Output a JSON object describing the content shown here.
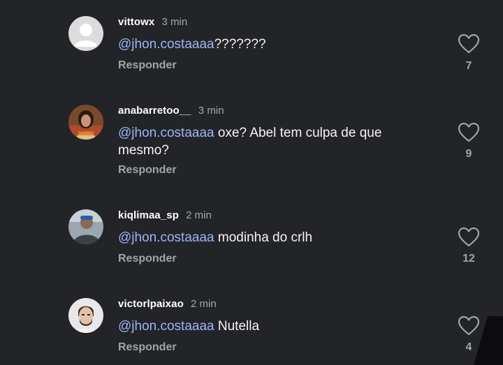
{
  "comments": [
    {
      "username": "vittowx",
      "time": "3 min",
      "mention": "@jhon.costaaaa",
      "text": "???????",
      "reply": "Responder",
      "likes": "7",
      "avatar_icon": "default-avatar-icon"
    },
    {
      "username": "anabarretoo__",
      "time": "3 min",
      "mention": "@jhon.costaaaa",
      "text": " oxe? Abel tem culpa de que mesmo?",
      "reply": "Responder",
      "likes": "9",
      "avatar_icon": "profile-photo"
    },
    {
      "username": "kiqlimaa_sp",
      "time": "2 min",
      "mention": "@jhon.costaaaa",
      "text": " modinha do crlh",
      "reply": "Responder",
      "likes": "12",
      "avatar_icon": "profile-photo"
    },
    {
      "username": "victorlpaixao",
      "time": "2 min",
      "mention": "@jhon.costaaaa",
      "text": " Nutella",
      "reply": "Responder",
      "likes": "4",
      "avatar_icon": "profile-photo"
    }
  ],
  "colors": {
    "background": "#232428",
    "mention": "#9fb4f5",
    "secondary_text": "#a3a4a9"
  }
}
